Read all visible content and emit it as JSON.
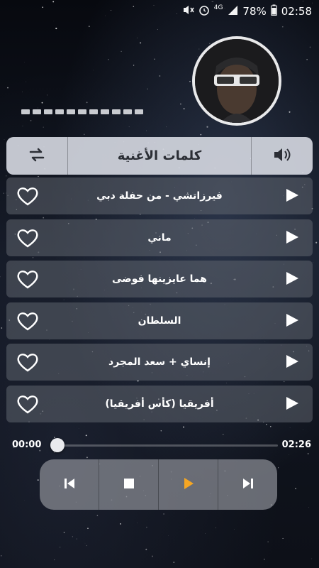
{
  "status_bar": {
    "network": "4G",
    "battery": "78%",
    "time": "02:58"
  },
  "header": {
    "title": "كلمات الأغنية",
    "left_icon": "repeat-icon",
    "right_icon": "volume-icon"
  },
  "tracks": [
    {
      "title": "فيرزاتشي - من حفلة دبي"
    },
    {
      "title": "ماني"
    },
    {
      "title": "هما عايزينها فوضى"
    },
    {
      "title": "السلطان"
    },
    {
      "title": "إنساي + سعد المجرد"
    },
    {
      "title": "أفريقيا (كأس أفريقيا)"
    }
  ],
  "player": {
    "elapsed": "00:00",
    "duration": "02:26",
    "progress": 0.0,
    "accent": "#f5a623"
  },
  "colors": {
    "header_bg": "#d2d6de",
    "row_bg": "#5f646e",
    "controls_bg": "#878a91"
  }
}
